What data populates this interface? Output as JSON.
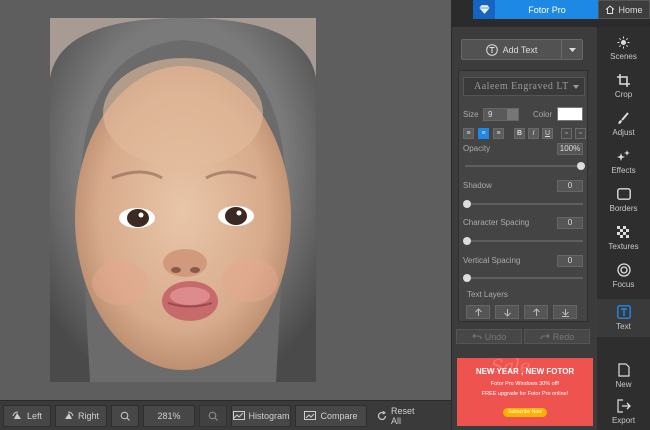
{
  "header": {
    "fotor_pro_label": "Fotor Pro",
    "home_label": "Home"
  },
  "bottom_toolbar": {
    "rotate_left_label": "Left",
    "rotate_right_label": "Right",
    "zoom_value": "281%",
    "histogram_label": "Histogram",
    "compare_label": "Compare",
    "reset_all_label": "Reset All"
  },
  "text_panel": {
    "add_text_label": "Add Text",
    "font_name": "Aaleem Engraved LT",
    "size_label": "Size",
    "size_value": "9",
    "color_label": "Color",
    "text_color": "#ffffff",
    "format_buttons": [
      "align-left",
      "align-center",
      "align-right",
      "bold",
      "italic",
      "underline"
    ],
    "opacity_label": "Opacity",
    "opacity_value": "100%",
    "opacity_level": 1.0,
    "shadow_label": "Shadow",
    "shadow_value": "0",
    "char_spacing_label": "Character Spacing",
    "char_spacing_value": "0",
    "vert_spacing_label": "Vertical Spacing",
    "vert_spacing_value": "0",
    "text_layers_label": "Text Layers",
    "undo_label": "Undo",
    "redo_label": "Redo"
  },
  "promo": {
    "headline": "NEW YEAR , NEW FOTOR",
    "line1": "Fotor Pro Windows 30% off!",
    "line2": "FREE upgrade for Fotor Pro online!",
    "button": "Subscribe Now"
  },
  "tools": [
    {
      "label": "Scenes",
      "icon": "sun-icon"
    },
    {
      "label": "Crop",
      "icon": "crop-icon"
    },
    {
      "label": "Adjust",
      "icon": "brush-icon"
    },
    {
      "label": "Effects",
      "icon": "sparkles-icon"
    },
    {
      "label": "Borders",
      "icon": "frame-icon"
    },
    {
      "label": "Textures",
      "icon": "checker-icon"
    },
    {
      "label": "Focus",
      "icon": "target-icon"
    },
    {
      "label": "Text",
      "icon": "text-icon"
    },
    {
      "label": "New",
      "icon": "new-doc-icon"
    },
    {
      "label": "Export",
      "icon": "export-icon"
    }
  ],
  "colors": {
    "accent": "#1e88e5",
    "panel_bg": "#3c3c3c",
    "canvas_bg": "#5e5e5e",
    "promo_bg": "#ef5350"
  }
}
